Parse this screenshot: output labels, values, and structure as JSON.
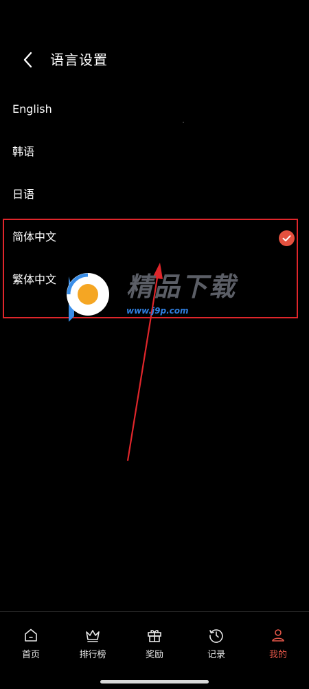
{
  "header": {
    "title": "语言设置",
    "back_icon": "chevron-left-icon"
  },
  "languages": [
    {
      "label": "English",
      "selected": false
    },
    {
      "label": "韩语",
      "selected": false
    },
    {
      "label": "日语",
      "selected": false
    },
    {
      "label": "简体中文",
      "selected": true
    },
    {
      "label": "繁体中文",
      "selected": false
    }
  ],
  "watermark": {
    "text": "精品下载",
    "url": "www.j9p.com"
  },
  "bottom_nav": [
    {
      "label": "首页",
      "icon": "home-icon",
      "active": false
    },
    {
      "label": "排行榜",
      "icon": "crown-icon",
      "active": false
    },
    {
      "label": "奖励",
      "icon": "gift-icon",
      "active": false
    },
    {
      "label": "记录",
      "icon": "history-icon",
      "active": false
    },
    {
      "label": "我的",
      "icon": "user-icon",
      "active": true
    }
  ],
  "colors": {
    "background": "#000000",
    "accent": "#e8584a",
    "annotation": "#e0262b",
    "check_fill": "#e4513f"
  }
}
